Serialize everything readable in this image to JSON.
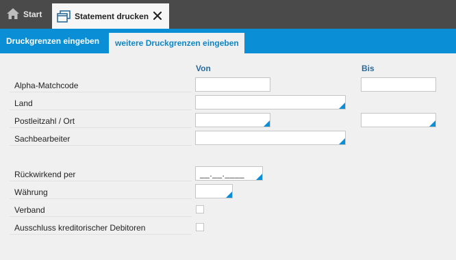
{
  "tabs": {
    "start_label": "Start",
    "active_label": "Statement drucken"
  },
  "subtabs": [
    "Druckgrenzen eingeben",
    "weitere Druckgrenzen eingeben"
  ],
  "columns": {
    "von": "Von",
    "bis": "Bis"
  },
  "rows": {
    "alpha_matchcode": "Alpha-Matchcode",
    "land": "Land",
    "plz_ort": "Postleitzahl / Ort",
    "sachbearbeiter": "Sachbearbeiter",
    "rueckwirkend": "Rückwirkend per",
    "waehrung": "Währung",
    "verband": "Verband",
    "ausschluss": "Ausschluss kreditorischer Debitoren"
  },
  "values": {
    "rueckwirkend_date": "__.__.____"
  },
  "colors": {
    "topbar": "#4a4a4a",
    "accent": "#0a8fd6",
    "header_text": "#2a6a9a"
  }
}
